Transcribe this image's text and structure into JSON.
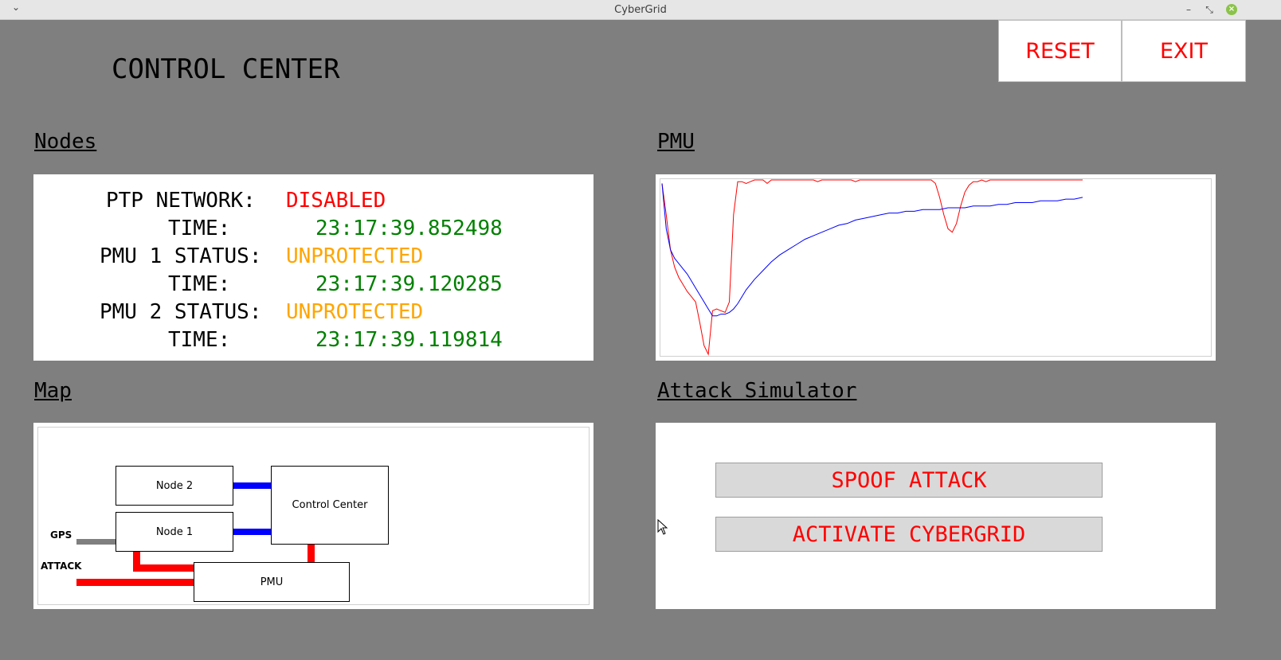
{
  "window": {
    "title": "CyberGrid",
    "menu_glyph": "⌄",
    "minimize": "–",
    "maximize": "⤡",
    "close": "×"
  },
  "header": {
    "title": "CONTROL CENTER",
    "reset_label": "RESET",
    "exit_label": "EXIT"
  },
  "nodes": {
    "section_label": "Nodes",
    "ptp_label": "PTP NETWORK:",
    "ptp_value": "DISABLED",
    "ptp_time_label": "TIME:",
    "ptp_time": "23:17:39.852498",
    "pmu1_label": "PMU 1 STATUS:",
    "pmu1_value": "UNPROTECTED",
    "pmu1_time_label": "TIME:",
    "pmu1_time": "23:17:39.120285",
    "pmu2_label": "PMU 2 STATUS:",
    "pmu2_value": "UNPROTECTED",
    "pmu2_time_label": "TIME:",
    "pmu2_time": "23:17:39.119814",
    "colors": {
      "disabled": "#ff0000",
      "unprotected": "#ffa500",
      "time": "#008000"
    }
  },
  "pmu": {
    "section_label": "PMU",
    "chart_data": {
      "type": "line",
      "title": "",
      "xlabel": "",
      "ylabel": "",
      "xlim": [
        0,
        100
      ],
      "ylim": [
        0,
        100
      ],
      "grid": false,
      "series": [
        {
          "color": "#ff0000",
          "x": [
            0,
            1,
            2,
            3,
            4,
            5,
            6,
            7,
            8,
            9,
            10,
            11,
            12,
            13,
            14,
            15,
            16,
            17,
            18,
            19,
            20,
            21,
            22,
            23,
            24,
            25,
            26,
            27,
            28,
            29,
            30,
            31,
            32,
            33,
            34,
            35,
            36,
            37,
            38,
            39,
            40,
            41,
            42,
            43,
            44,
            45,
            46,
            47,
            48,
            49,
            50,
            51,
            52,
            53,
            54,
            55,
            56,
            57,
            58,
            59,
            60,
            61,
            62,
            63,
            64,
            65,
            66,
            67,
            68,
            69,
            70,
            71,
            72,
            73,
            74,
            75,
            76,
            77,
            78,
            79,
            80,
            81,
            82,
            83,
            84,
            85,
            86,
            87,
            88,
            89,
            90,
            91,
            92,
            93,
            94,
            95,
            96,
            97,
            98,
            99,
            100
          ],
          "values": [
            98,
            80,
            60,
            50,
            44,
            40,
            36,
            33,
            30,
            18,
            5,
            0,
            25,
            26,
            25,
            24,
            30,
            80,
            99,
            99,
            98,
            99,
            100,
            100,
            100,
            98,
            100,
            100,
            100,
            100,
            100,
            100,
            100,
            100,
            100,
            100,
            100,
            99,
            100,
            100,
            100,
            100,
            100,
            100,
            100,
            100,
            99,
            100,
            100,
            100,
            100,
            100,
            100,
            100,
            100,
            100,
            100,
            100,
            100,
            100,
            100,
            100,
            100,
            100,
            100,
            98,
            90,
            80,
            72,
            70,
            75,
            85,
            93,
            97,
            99,
            99,
            100,
            99,
            100,
            100,
            100,
            100,
            100,
            100,
            100,
            100,
            100,
            100,
            100,
            100,
            100,
            100,
            100,
            100,
            100,
            100,
            100,
            100,
            100,
            100,
            100
          ]
        },
        {
          "color": "#0000ff",
          "x": [
            0,
            1,
            2,
            3,
            4,
            5,
            6,
            7,
            8,
            9,
            10,
            11,
            12,
            13,
            14,
            15,
            16,
            17,
            18,
            19,
            20,
            22,
            24,
            26,
            28,
            30,
            32,
            34,
            36,
            38,
            40,
            42,
            44,
            46,
            48,
            50,
            52,
            54,
            56,
            58,
            60,
            62,
            64,
            66,
            68,
            70,
            72,
            74,
            76,
            78,
            80,
            82,
            84,
            86,
            88,
            90,
            92,
            94,
            96,
            98,
            100
          ],
          "values": [
            98,
            72,
            60,
            55,
            52,
            49,
            46,
            42,
            38,
            34,
            30,
            26,
            22,
            22,
            23,
            23,
            24,
            26,
            29,
            33,
            37,
            43,
            48,
            53,
            57,
            60,
            63,
            66,
            68,
            70,
            72,
            74,
            75,
            77,
            78,
            79,
            80,
            81,
            81,
            82,
            82,
            83,
            83,
            83,
            84,
            84,
            84,
            85,
            85,
            85,
            86,
            86,
            87,
            87,
            87,
            88,
            88,
            88,
            89,
            89,
            90
          ]
        }
      ]
    }
  },
  "map": {
    "section_label": "Map",
    "node2": "Node 2",
    "node1": "Node 1",
    "control_center": "Control Center",
    "pmu": "PMU",
    "gps": "GPS",
    "attack": "ATTACK",
    "colors": {
      "link": "#0000ff",
      "attack": "#ff0000",
      "gps": "#7f7f7f"
    }
  },
  "attack": {
    "section_label": "Attack Simulator",
    "spoof_label": "SPOOF ATTACK",
    "activate_label": "ACTIVATE CYBERGRID"
  }
}
